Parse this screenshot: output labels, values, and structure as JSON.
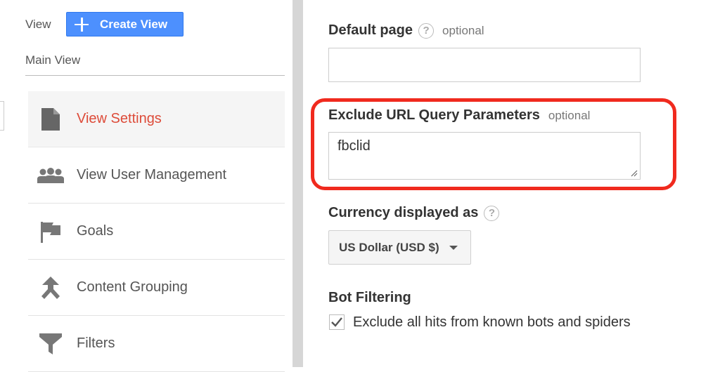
{
  "header": {
    "view_label": "View",
    "create_view_label": "Create View",
    "current_view": "Main View"
  },
  "nav": {
    "items": [
      {
        "label": "View Settings",
        "icon": "document-icon",
        "active": true
      },
      {
        "label": "View User Management",
        "icon": "users-icon",
        "active": false
      },
      {
        "label": "Goals",
        "icon": "flag-icon",
        "active": false
      },
      {
        "label": "Content Grouping",
        "icon": "content-grouping-icon",
        "active": false
      },
      {
        "label": "Filters",
        "icon": "filter-icon",
        "active": false
      }
    ]
  },
  "form": {
    "default_page": {
      "label": "Default page",
      "help": "?",
      "optional": "optional",
      "value": ""
    },
    "exclude_params": {
      "label": "Exclude URL Query Parameters",
      "optional": "optional",
      "value": "fbclid"
    },
    "currency": {
      "label": "Currency displayed as",
      "help": "?",
      "selected": "US Dollar (USD $)"
    },
    "bot_filtering": {
      "label": "Bot Filtering",
      "checkbox_label": "Exclude all hits from known bots and spiders",
      "checked": true
    }
  },
  "colors": {
    "accent_blue": "#4d90fe",
    "active_red": "#dd4b39",
    "highlight_red": "#f02a1e"
  }
}
